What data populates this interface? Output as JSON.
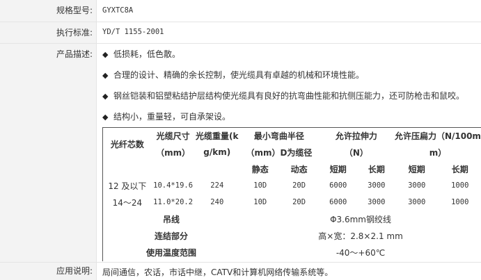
{
  "rows": {
    "model": {
      "label": "规格型号:",
      "value": "GYXTC8A"
    },
    "standard": {
      "label": "执行标准:",
      "value": "YD/T 1155-2001"
    },
    "description": {
      "label": "产品描述:",
      "bullet_glyph": "◆",
      "items": [
        "低损耗，低色散。",
        "合理的设计、精确的余长控制，使光缆具有卓越的机械和环境性能。",
        "钢丝铠装和铝塑粘结护层结构使光缆具有良好的抗弯曲性能和抗侧压能力，还可防枪击和鼠咬。",
        "结构小，重量轻，可自承架设。"
      ]
    },
    "application": {
      "label": "应用说明:",
      "value": "局间通信，农话，市话中继，CATV和计算机网络传输系统等。"
    }
  },
  "spec_table": {
    "headers": {
      "fiber_count": "光纤芯数",
      "size_line1": "光缆尺寸",
      "size_line2": "（mm）",
      "weight_line1": "光缆重量(k",
      "weight_line2": "g/km)",
      "bend_line1": "最小弯曲半径",
      "bend_line2": "（mm）D为缆径",
      "tensile_line1": "允许拉伸力",
      "tensile_line2": "（N）",
      "crush_line1": "允许压扁力（N/100m",
      "crush_line2": "m）",
      "static": "静态",
      "dynamic": "动态",
      "short_term_1": "短期",
      "long_term_1": "长期",
      "short_term_2": "短期",
      "long_term_2": "长期"
    },
    "data_rows": [
      [
        "12 及以下",
        "10.4*19.6",
        "224",
        "10D",
        "20D",
        "6000",
        "3000",
        "3000",
        "1000"
      ],
      [
        "14～24",
        "11.0*20.2",
        "240",
        "10D",
        "20D",
        "6000",
        "3000",
        "3000",
        "1000"
      ]
    ],
    "extra_rows": [
      {
        "label": "吊线",
        "value": "Φ3.6mm钢绞线"
      },
      {
        "label": "连结部分",
        "value": "高×宽：2.8×2.1 mm"
      },
      {
        "label": "使用温度范围",
        "value": "-40～+60℃"
      }
    ]
  }
}
